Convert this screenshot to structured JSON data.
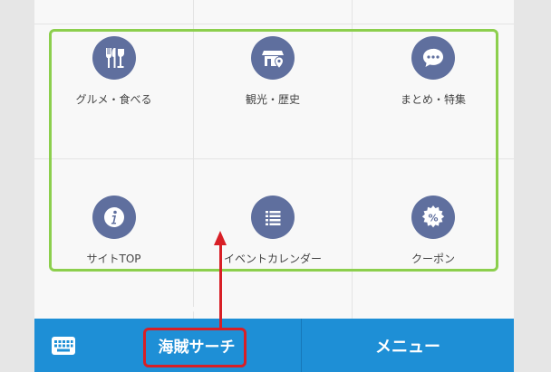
{
  "menu_grid": [
    {
      "label": "グルメ・食べる",
      "icon": "cutlery-icon"
    },
    {
      "label": "観光・歴史",
      "icon": "shop-location-icon"
    },
    {
      "label": "まとめ・特集",
      "icon": "speech-bubble-icon"
    },
    {
      "label": "サイトTOP",
      "icon": "info-icon"
    },
    {
      "label": "イベントカレンダー",
      "icon": "list-icon"
    },
    {
      "label": "クーポン",
      "icon": "coupon-icon"
    }
  ],
  "bottom_bar": {
    "keyboard_icon": "keyboard-icon",
    "search_label": "海賊サーチ",
    "menu_label": "メニュー"
  },
  "colors": {
    "icon_bg": "#5f6f9e",
    "bar_bg": "#1e8fd6",
    "highlight_green": "#8ccf4d",
    "annotation_red": "#d81f26"
  }
}
